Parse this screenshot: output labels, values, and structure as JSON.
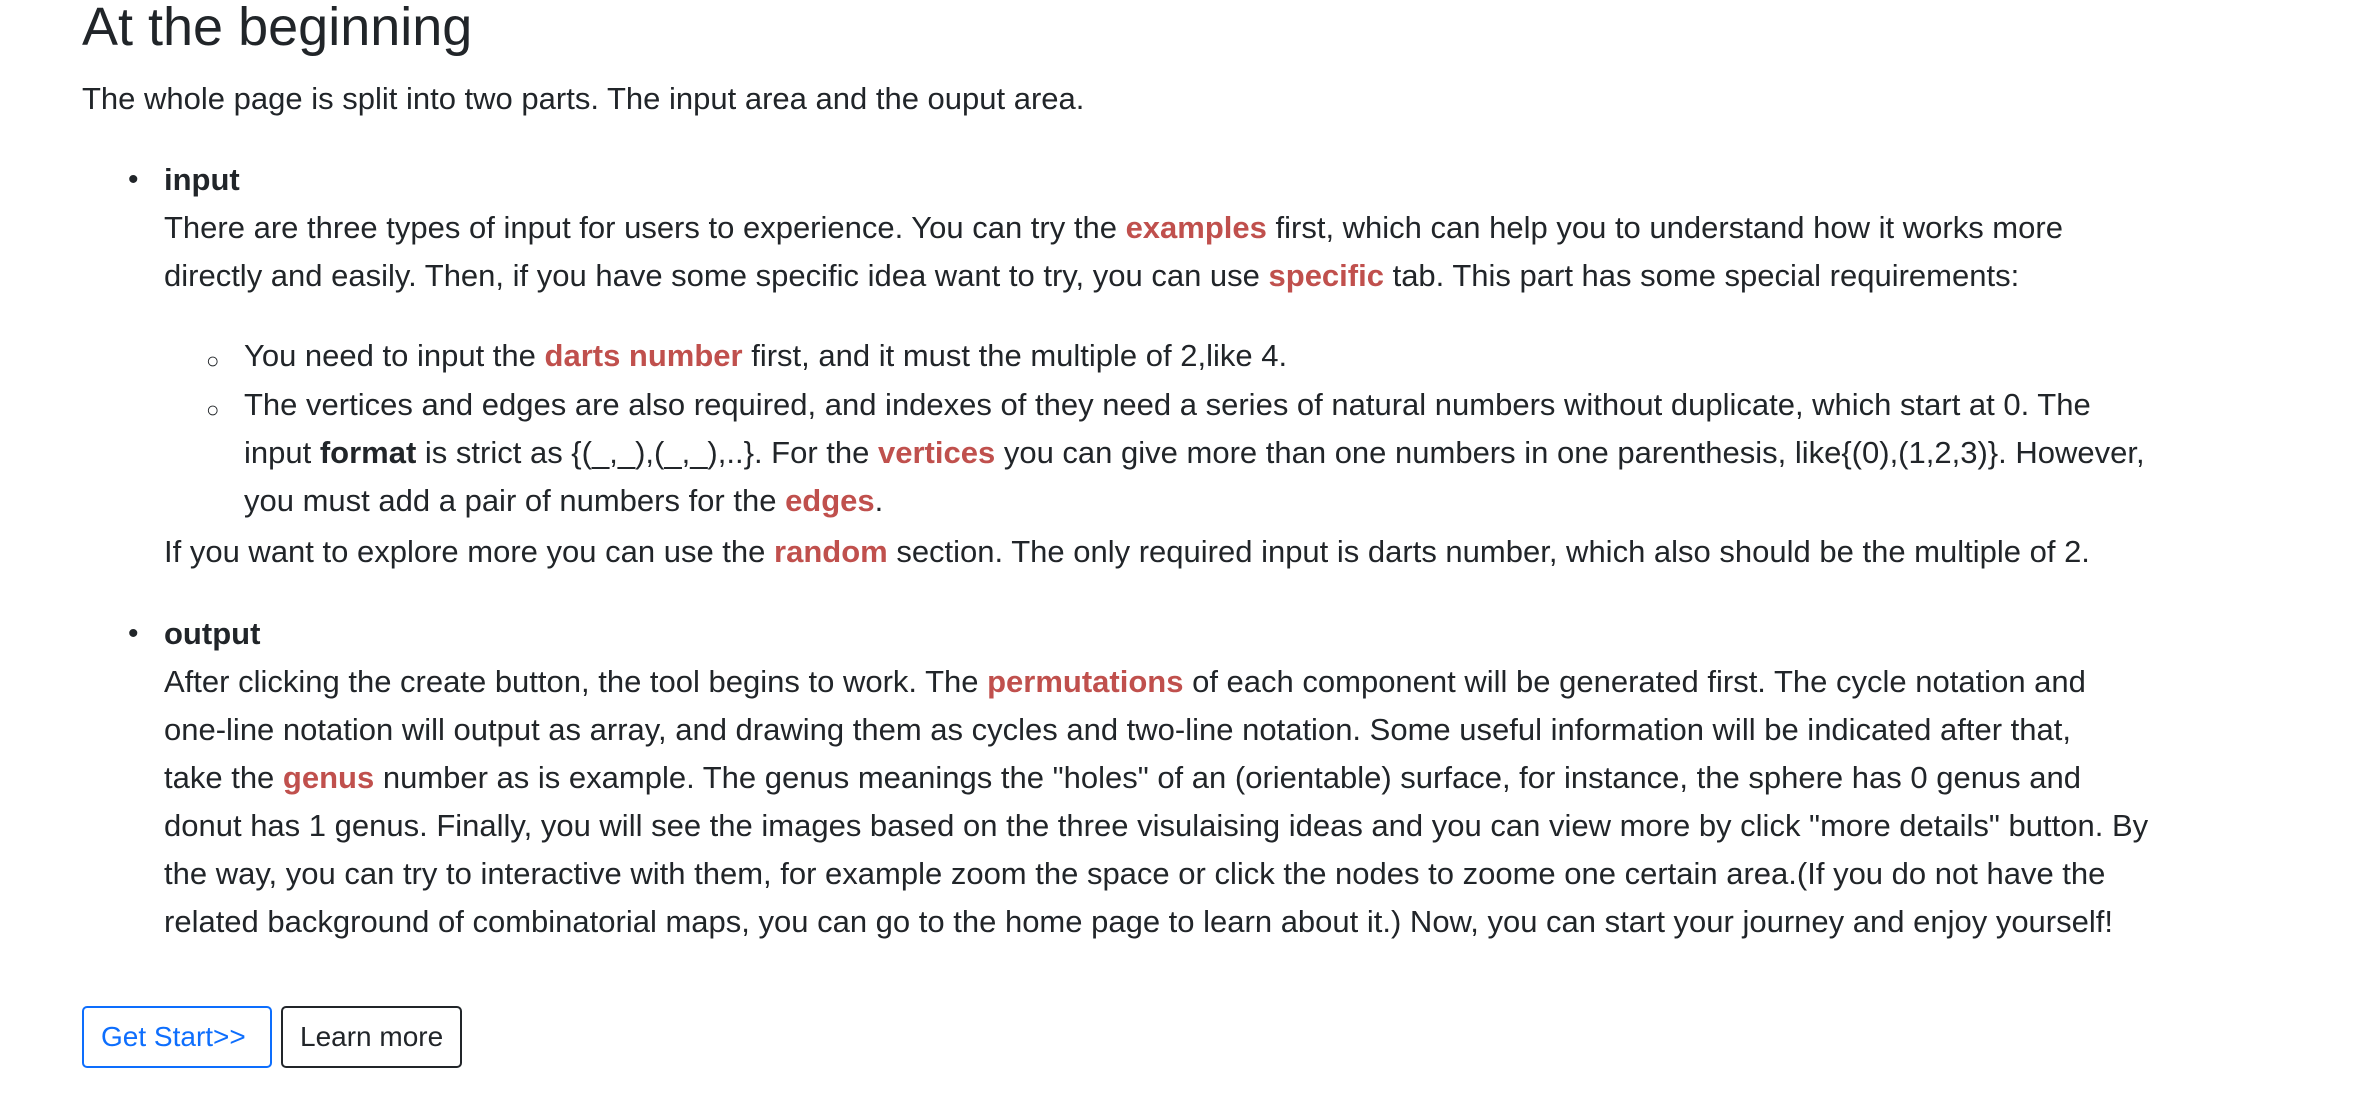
{
  "heading": "At the beginning",
  "intro": "The whole page is split into two parts. The input area and the ouput area.",
  "input": {
    "title": "input",
    "p1": [
      "There are three types of input for users to experience. You can try the ",
      "examples",
      " first, which can help you to understand how it works more"
    ],
    "p2": [
      "directly and easily. Then, if you have some specific idea want to try, you can use ",
      "specific",
      " tab. This part has some special requirements:"
    ],
    "sub1": [
      "You need to input the ",
      "darts number",
      " first, and it must the multiple of 2,like 4."
    ],
    "sub2_l1": "The vertices and edges are also required, and indexes of they need a series of natural numbers without duplicate, which start at 0. The",
    "sub2_l2": [
      "input ",
      "format",
      " is strict as {(_,_),(_,_),..}. For the ",
      "vertices",
      " you can give more than one numbers in one parenthesis, like{(0),(1,2,3)}. However,"
    ],
    "sub2_l3": [
      "you must add a pair of numbers for the ",
      "edges",
      "."
    ],
    "random": [
      "If you want to explore more you can use the ",
      "random",
      " section. The only required input is darts number, which also should be the multiple of 2."
    ]
  },
  "output": {
    "title": "output",
    "l1": [
      "After clicking the create button, the tool begins to work. The ",
      "permutations",
      " of each component will be generated first. The cycle notation and"
    ],
    "l2": "one-line notation will output as array, and drawing them as cycles and two-line notation. Some useful information will be indicated after that,",
    "l3": [
      "take the ",
      "genus",
      " number as is example. The genus meanings the \"holes\" of an (orientable) surface, for instance, the sphere has 0 genus and"
    ],
    "l4": "donut has 1 genus. Finally, you will see the images based on the three visulaising ideas and you can view more by click \"more details\" button. By",
    "l5": "the way, you can try to interactive with them, for example zoom the space or click the nodes to zoome one certain area.(If you do not have the",
    "l6": "related background of combinatorial maps, you can go to the home page to learn about it.) Now, you can start your journey and enjoy yourself!"
  },
  "buttons": {
    "get_start": "Get Start>>",
    "learn_more": "Learn more"
  },
  "colors": {
    "highlight": "#c0504d",
    "primary": "#0d6efd",
    "text": "#212529"
  }
}
